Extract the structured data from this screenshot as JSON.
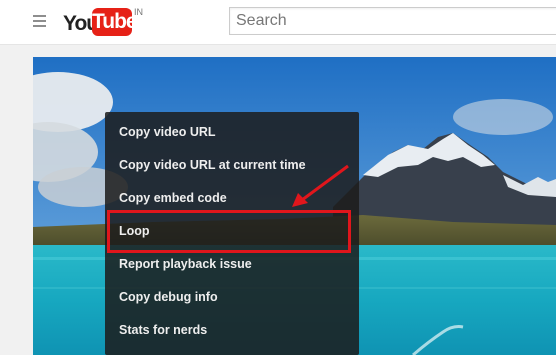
{
  "header": {
    "logo_you": "You",
    "logo_tube": "Tube",
    "logo_region": "IN",
    "search_placeholder": "Search"
  },
  "context_menu": {
    "items": [
      {
        "label": "Copy video URL"
      },
      {
        "label": "Copy video URL at current time"
      },
      {
        "label": "Copy embed code"
      },
      {
        "label": "Loop"
      },
      {
        "label": "Report playback issue"
      },
      {
        "label": "Copy debug info"
      },
      {
        "label": "Stats for nerds"
      }
    ],
    "highlighted_item": "Loop"
  },
  "colors": {
    "brand_red": "#e62117",
    "annotation_red": "#e0161c",
    "menu_background": "#1c1c1c"
  },
  "icons": [
    "hamburger-menu-icon"
  ]
}
